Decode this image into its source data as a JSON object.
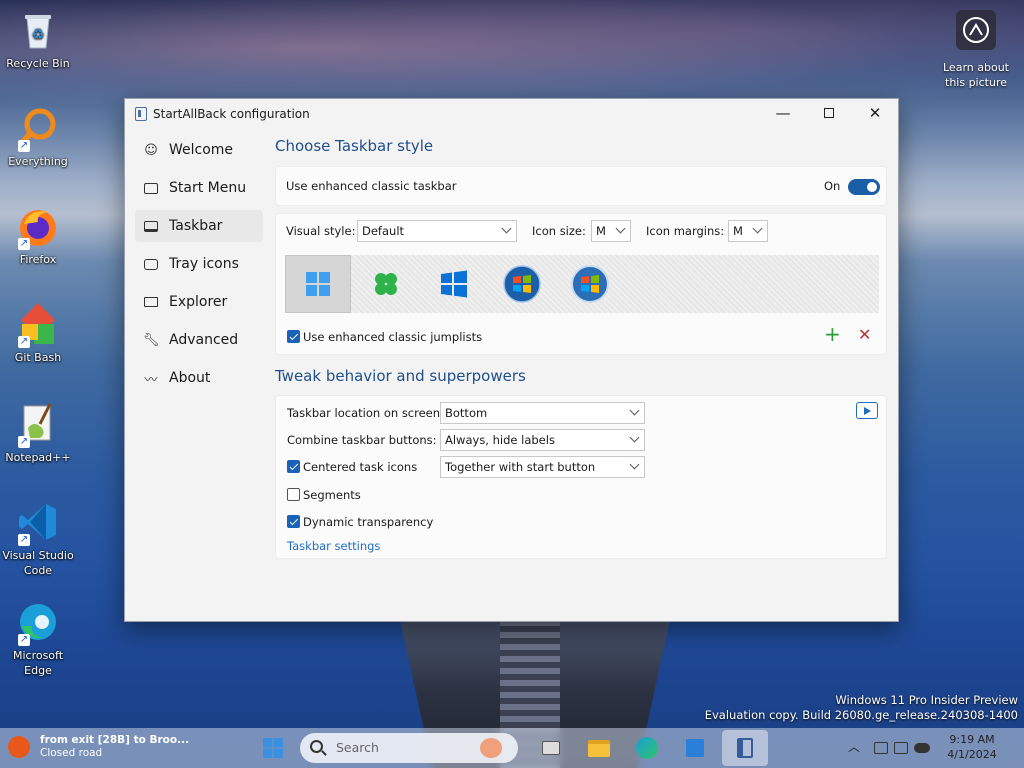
{
  "desktop": {
    "icons": [
      {
        "label": "Recycle Bin"
      },
      {
        "label": "Everything"
      },
      {
        "label": "Firefox"
      },
      {
        "label": "Git Bash"
      },
      {
        "label": "Notepad++"
      },
      {
        "label": "Visual Studio Code"
      },
      {
        "label": "Microsoft Edge"
      }
    ],
    "learn_label": "Learn about this picture",
    "watermark": {
      "line1": "Windows 11 Pro Insider Preview",
      "line2": "Evaluation copy. Build 26080.ge_release.240308-1400"
    }
  },
  "window": {
    "title": "StartAllBack configuration",
    "nav": [
      {
        "label": "Welcome",
        "icon": "smile-icon"
      },
      {
        "label": "Start Menu",
        "icon": "start-menu-icon"
      },
      {
        "label": "Taskbar",
        "icon": "taskbar-icon"
      },
      {
        "label": "Tray icons",
        "icon": "tray-icon"
      },
      {
        "label": "Explorer",
        "icon": "folder-icon"
      },
      {
        "label": "Advanced",
        "icon": "wrench-icon"
      },
      {
        "label": "About",
        "icon": "signature-icon"
      }
    ],
    "active_nav": "Taskbar",
    "section1_title": "Choose Taskbar style",
    "enhanced_classic": {
      "label": "Use enhanced classic taskbar",
      "state": "On"
    },
    "visual_style": {
      "label": "Visual style:",
      "value": "Default"
    },
    "icon_size": {
      "label": "Icon size:",
      "value": "M"
    },
    "icon_margins": {
      "label": "Icon margins:",
      "value": "M"
    },
    "style_options": [
      "windows11-logo",
      "clover-logo",
      "windows10-logo",
      "windows7-orb",
      "vista-orb"
    ],
    "jumplists": {
      "label": "Use enhanced classic jumplists",
      "checked": true
    },
    "section2_title": "Tweak behavior and superpowers",
    "location": {
      "label": "Taskbar location on screen:",
      "value": "Bottom"
    },
    "combine": {
      "label": "Combine taskbar buttons:",
      "value": "Always, hide labels"
    },
    "centered": {
      "label": "Centered task icons",
      "checked": true,
      "value": "Together with start button"
    },
    "segments": {
      "label": "Segments",
      "checked": false
    },
    "dynamic": {
      "label": "Dynamic transparency",
      "checked": true
    },
    "settings_link": "Taskbar settings"
  },
  "taskbar": {
    "news_title": "from exit [28B] to Broo...",
    "news_sub": "Closed road",
    "search_placeholder": "Search",
    "clock_time": "9:19 AM",
    "clock_date": "4/1/2024"
  },
  "colors": {
    "accent": "#1a5ea8",
    "section_title": "#1f4e8c",
    "link": "#1f6dbf"
  }
}
